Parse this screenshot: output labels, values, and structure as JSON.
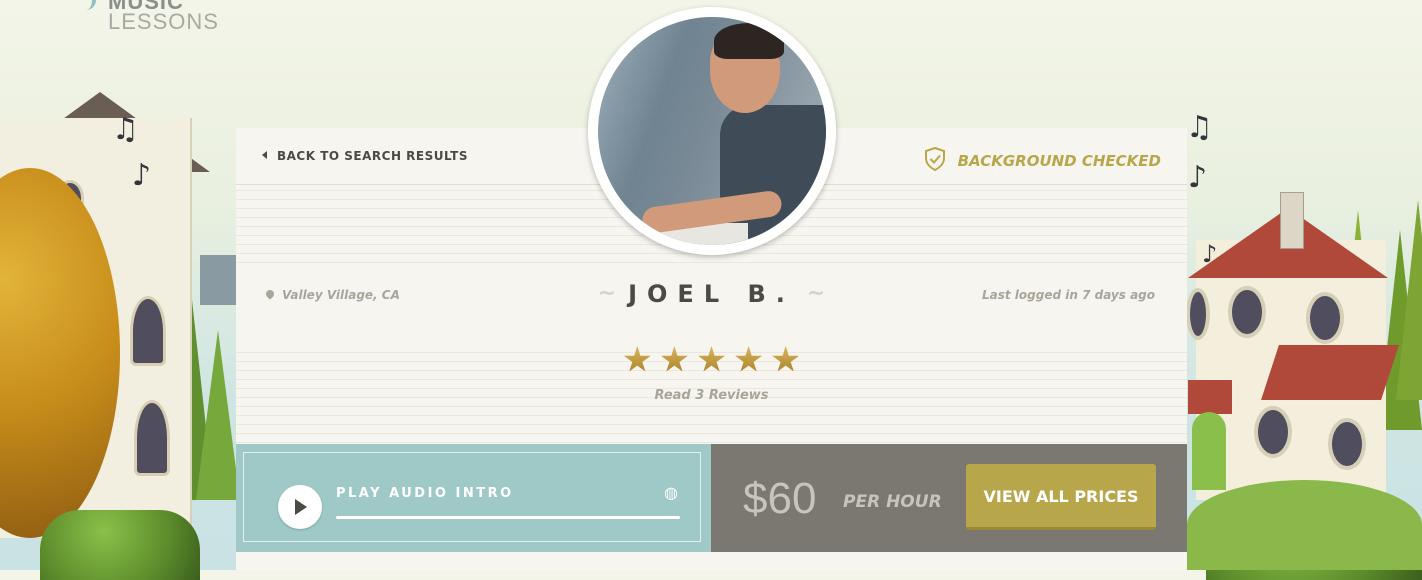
{
  "logo": {
    "line1": "MUSIC",
    "line2": "LESSONS"
  },
  "nav": {
    "back_label": "BACK TO SEARCH RESULTS"
  },
  "badge": {
    "label": "BACKGROUND CHECKED"
  },
  "teacher": {
    "name": "JOEL B.",
    "location": "Valley Village, CA",
    "last_login": "Last logged in 7 days ago",
    "rating": 5,
    "reviews_label": "Read 3 Reviews"
  },
  "audio": {
    "label": "PLAY AUDIO INTRO"
  },
  "pricing": {
    "price": "$60",
    "unit": "PER HOUR",
    "button_label": "VIEW ALL PRICES"
  },
  "colors": {
    "accent": "#b8a74a",
    "audio_bg": "#9fc9c7",
    "price_bg": "#7b7771",
    "text_dark": "#4c4a45"
  },
  "icons": [
    "back-arrow-icon",
    "shield-check-icon",
    "map-pin-icon",
    "star-icon",
    "play-icon",
    "volume-icon",
    "music-note-icon"
  ]
}
